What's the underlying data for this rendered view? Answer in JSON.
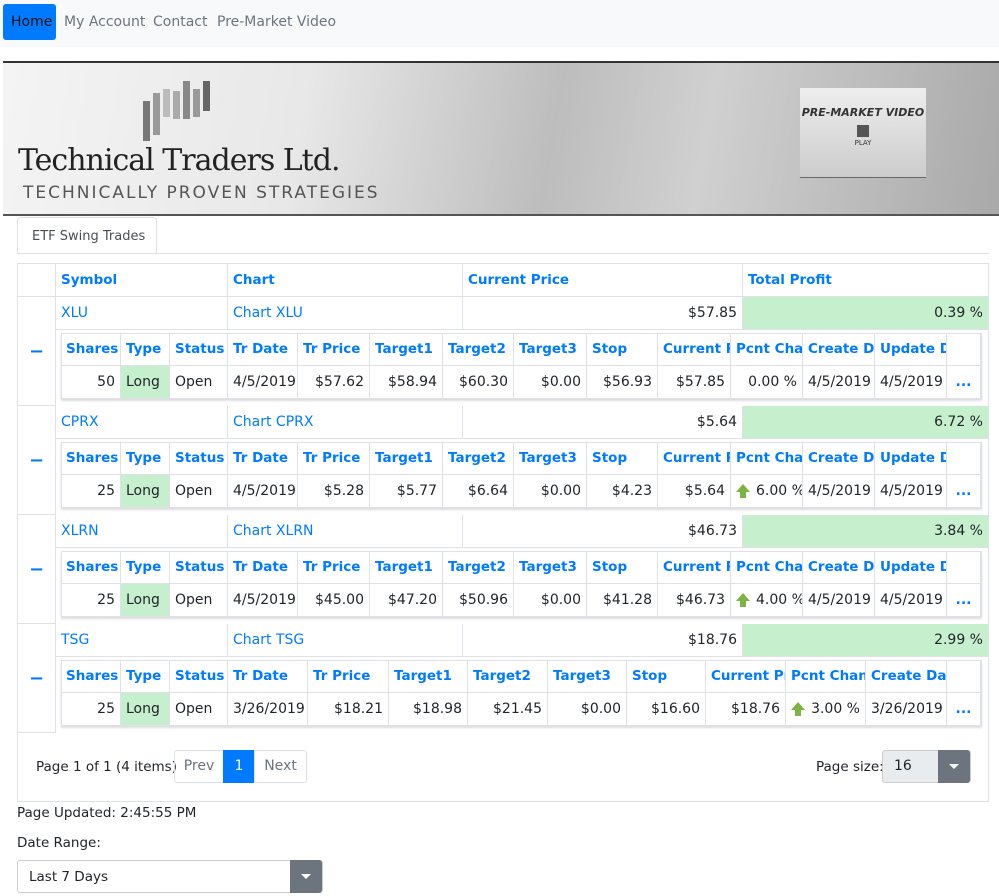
{
  "nav": {
    "items": [
      "Home",
      "My Account",
      "Contact",
      "Pre-Market Video"
    ]
  },
  "banner": {
    "title": "Technical Traders Ltd.",
    "tagline": "TECHNICALLY PROVEN STRATEGIES",
    "video_title": "PRE-MARKET VIDEO",
    "video_play": "PLAY"
  },
  "tab": "ETF Swing Trades",
  "grid": {
    "headers": [
      "Symbol",
      "Chart",
      "Current Price",
      "Total Profit"
    ],
    "detail_headers": [
      "Shares",
      "Type",
      "Status",
      "Tr Date",
      "Tr Price",
      "Target1",
      "Target2",
      "Target3",
      "Stop",
      "Current Price",
      "Pcnt Change",
      "Create Date",
      "Update Date"
    ],
    "rows": [
      {
        "symbol": "XLU",
        "chart": "Chart XLU",
        "price": "$57.85",
        "profit": "0.39 %",
        "detail": {
          "shares": "50",
          "type": "Long",
          "status": "Open",
          "tr_date": "4/5/2019",
          "tr_price": "$57.62",
          "t1": "$58.94",
          "t2": "$60.30",
          "t3": "$0.00",
          "stop": "$56.93",
          "cur": "$57.85",
          "pct": "0.00 %",
          "up": false,
          "create": "4/5/2019",
          "update": "4/5/2019"
        }
      },
      {
        "symbol": "CPRX",
        "chart": "Chart CPRX",
        "price": "$5.64",
        "profit": "6.72 %",
        "detail": {
          "shares": "25",
          "type": "Long",
          "status": "Open",
          "tr_date": "4/5/2019",
          "tr_price": "$5.28",
          "t1": "$5.77",
          "t2": "$6.64",
          "t3": "$0.00",
          "stop": "$4.23",
          "cur": "$5.64",
          "pct": "6.00 %",
          "up": true,
          "create": "4/5/2019",
          "update": "4/5/2019"
        }
      },
      {
        "symbol": "XLRN",
        "chart": "Chart XLRN",
        "price": "$46.73",
        "profit": "3.84 %",
        "detail": {
          "shares": "25",
          "type": "Long",
          "status": "Open",
          "tr_date": "4/5/2019",
          "tr_price": "$45.00",
          "t1": "$47.20",
          "t2": "$50.96",
          "t3": "$0.00",
          "stop": "$41.28",
          "cur": "$46.73",
          "pct": "4.00 %",
          "up": true,
          "create": "4/5/2019",
          "update": "4/5/2019"
        }
      },
      {
        "symbol": "TSG",
        "chart": "Chart TSG",
        "price": "$18.76",
        "profit": "2.99 %",
        "detail": {
          "shares": "25",
          "type": "Long",
          "status": "Open",
          "tr_date": "3/26/2019",
          "tr_price": "$18.21",
          "t1": "$18.98",
          "t2": "$21.45",
          "t3": "$0.00",
          "stop": "$16.60",
          "cur": "$18.76",
          "pct": "3.00 %",
          "up": true,
          "create": "3/26/2019",
          "update": null
        }
      }
    ],
    "more": "..."
  },
  "pager": {
    "info": "Page 1 of 1 (4 items)",
    "prev": "Prev",
    "page": "1",
    "next": "Next",
    "size_label": "Page size:",
    "size": "16"
  },
  "updated": "Page Updated: 2:45:55 PM",
  "date_range": {
    "label": "Date Range:",
    "value": "Last 7 Days"
  }
}
